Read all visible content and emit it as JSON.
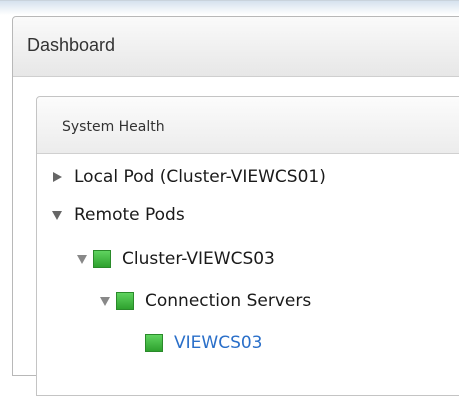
{
  "dashboard": {
    "title": "Dashboard"
  },
  "system_health": {
    "title": "System Health",
    "tree": {
      "local_pod": {
        "label": "Local Pod (Cluster-VIEWCS01)",
        "expanded": false
      },
      "remote_pods": {
        "label": "Remote Pods",
        "expanded": true
      },
      "cluster": {
        "label": "Cluster-VIEWCS03",
        "expanded": true,
        "status": "green"
      },
      "connection_servers": {
        "label": "Connection Servers",
        "expanded": true,
        "status": "green"
      },
      "server": {
        "label": "VIEWCS03",
        "status": "green"
      }
    }
  },
  "colors": {
    "status_green": "#3cb83c",
    "link_blue": "#2a6fc9",
    "toggle_gray": "#666666"
  }
}
